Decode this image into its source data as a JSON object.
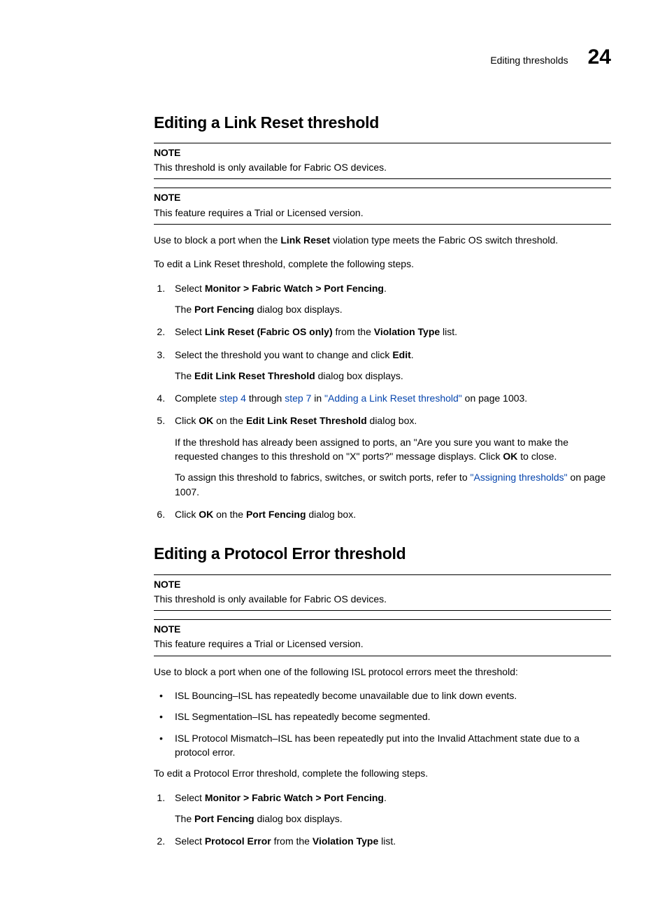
{
  "header": {
    "title": "Editing thresholds",
    "chapter": "24"
  },
  "s1": {
    "heading": "Editing a Link Reset threshold",
    "note1_label": "NOTE",
    "note1_body": "This threshold is only available for Fabric OS devices.",
    "note2_label": "NOTE",
    "note2_body": "This feature requires a Trial or Licensed version.",
    "intro1_a": "Use to block a port when the ",
    "intro1_b": "Link Reset",
    "intro1_c": " violation type meets the Fabric OS switch threshold.",
    "intro2": "To edit a Link Reset threshold, complete the following steps.",
    "step1_a": "Select ",
    "step1_b": "Monitor > Fabric Watch > Port Fencing",
    "step1_c": ".",
    "step1_sub_a": "The ",
    "step1_sub_b": "Port Fencing",
    "step1_sub_c": " dialog box displays.",
    "step2_a": "Select ",
    "step2_b": "Link Reset (Fabric OS only)",
    "step2_c": " from the ",
    "step2_d": "Violation Type",
    "step2_e": " list.",
    "step3_a": "Select the threshold you want to change and click ",
    "step3_b": "Edit",
    "step3_c": ".",
    "step3_sub_a": "The ",
    "step3_sub_b": "Edit Link Reset Threshold",
    "step3_sub_c": " dialog box displays.",
    "step4_a": "Complete ",
    "step4_link1": "step 4",
    "step4_b": " through ",
    "step4_link2": "step 7",
    "step4_c": " in ",
    "step4_link3": "\"Adding a Link Reset threshold\"",
    "step4_d": " on page 1003.",
    "step5_a": "Click ",
    "step5_b": "OK",
    "step5_c": " on the ",
    "step5_d": "Edit Link Reset Threshold",
    "step5_e": " dialog box.",
    "step5_sub1_a": "If the threshold has already been assigned to ports, an \"Are you sure you want to make the requested changes to this threshold on \"X\" ports?\" message displays. Click ",
    "step5_sub1_b": "OK",
    "step5_sub1_c": " to close.",
    "step5_sub2_a": "To assign this threshold to fabrics, switches, or switch ports, refer to ",
    "step5_sub2_link": "\"Assigning thresholds\"",
    "step5_sub2_b": " on page 1007.",
    "step6_a": "Click ",
    "step6_b": "OK",
    "step6_c": " on the ",
    "step6_d": "Port Fencing",
    "step6_e": " dialog box."
  },
  "s2": {
    "heading": "Editing a Protocol Error threshold",
    "note1_label": "NOTE",
    "note1_body": "This threshold is only available for Fabric OS devices.",
    "note2_label": "NOTE",
    "note2_body": "This feature requires a Trial or Licensed version.",
    "intro1": "Use to block a port when one of the following ISL protocol errors meet the threshold:",
    "bullet1": "ISL Bouncing–ISL has repeatedly become unavailable due to link down events.",
    "bullet2": "ISL Segmentation–ISL has repeatedly become segmented.",
    "bullet3": "ISL Protocol Mismatch–ISL has been repeatedly put into the Invalid Attachment state due to a protocol error.",
    "intro2": "To edit a Protocol Error threshold, complete the following steps.",
    "step1_a": "Select ",
    "step1_b": "Monitor > Fabric Watch > Port Fencing",
    "step1_c": ".",
    "step1_sub_a": "The ",
    "step1_sub_b": "Port Fencing",
    "step1_sub_c": " dialog box displays.",
    "step2_a": "Select ",
    "step2_b": "Protocol Error",
    "step2_c": " from the ",
    "step2_d": "Violation Type",
    "step2_e": " list."
  }
}
